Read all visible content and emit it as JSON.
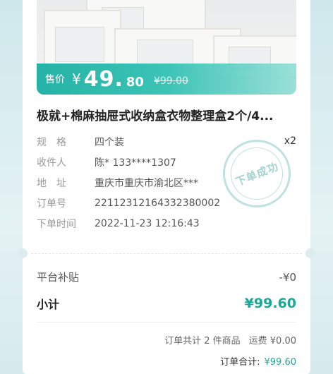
{
  "product": {
    "price_label": "售价",
    "currency": "¥",
    "price_int": "49.",
    "price_dec": "80",
    "original_price": "¥99.00",
    "title": "极就+棉麻抽屉式收纳盒衣物整理盒2个/4..."
  },
  "details": {
    "spec_label": "规　格",
    "spec_value": "四个装",
    "quantity": "x2",
    "recipient_label": "收件人",
    "recipient_value": "陈* 133****1307",
    "address_label": "地　址",
    "address_value": "重庆市重庆市渝北区***",
    "order_no_label": "订单号",
    "order_no_value": "22112312164332380002",
    "order_time_label": "下单时间",
    "order_time_value": "2022-11-23 12:16:43"
  },
  "stamp": {
    "text": "下单成功"
  },
  "summary": {
    "subsidy_label": "平台补贴",
    "subsidy_value": "-¥0",
    "subtotal_label": "小计",
    "subtotal_value": "¥99.60",
    "count_text": "订单共计 2 件商品",
    "shipping_text": "运费 ¥0.00",
    "total_label": "订单合计:",
    "total_value": "¥99.60"
  },
  "colors": {
    "accent": "#1aa898",
    "band": "#24b3a6"
  }
}
